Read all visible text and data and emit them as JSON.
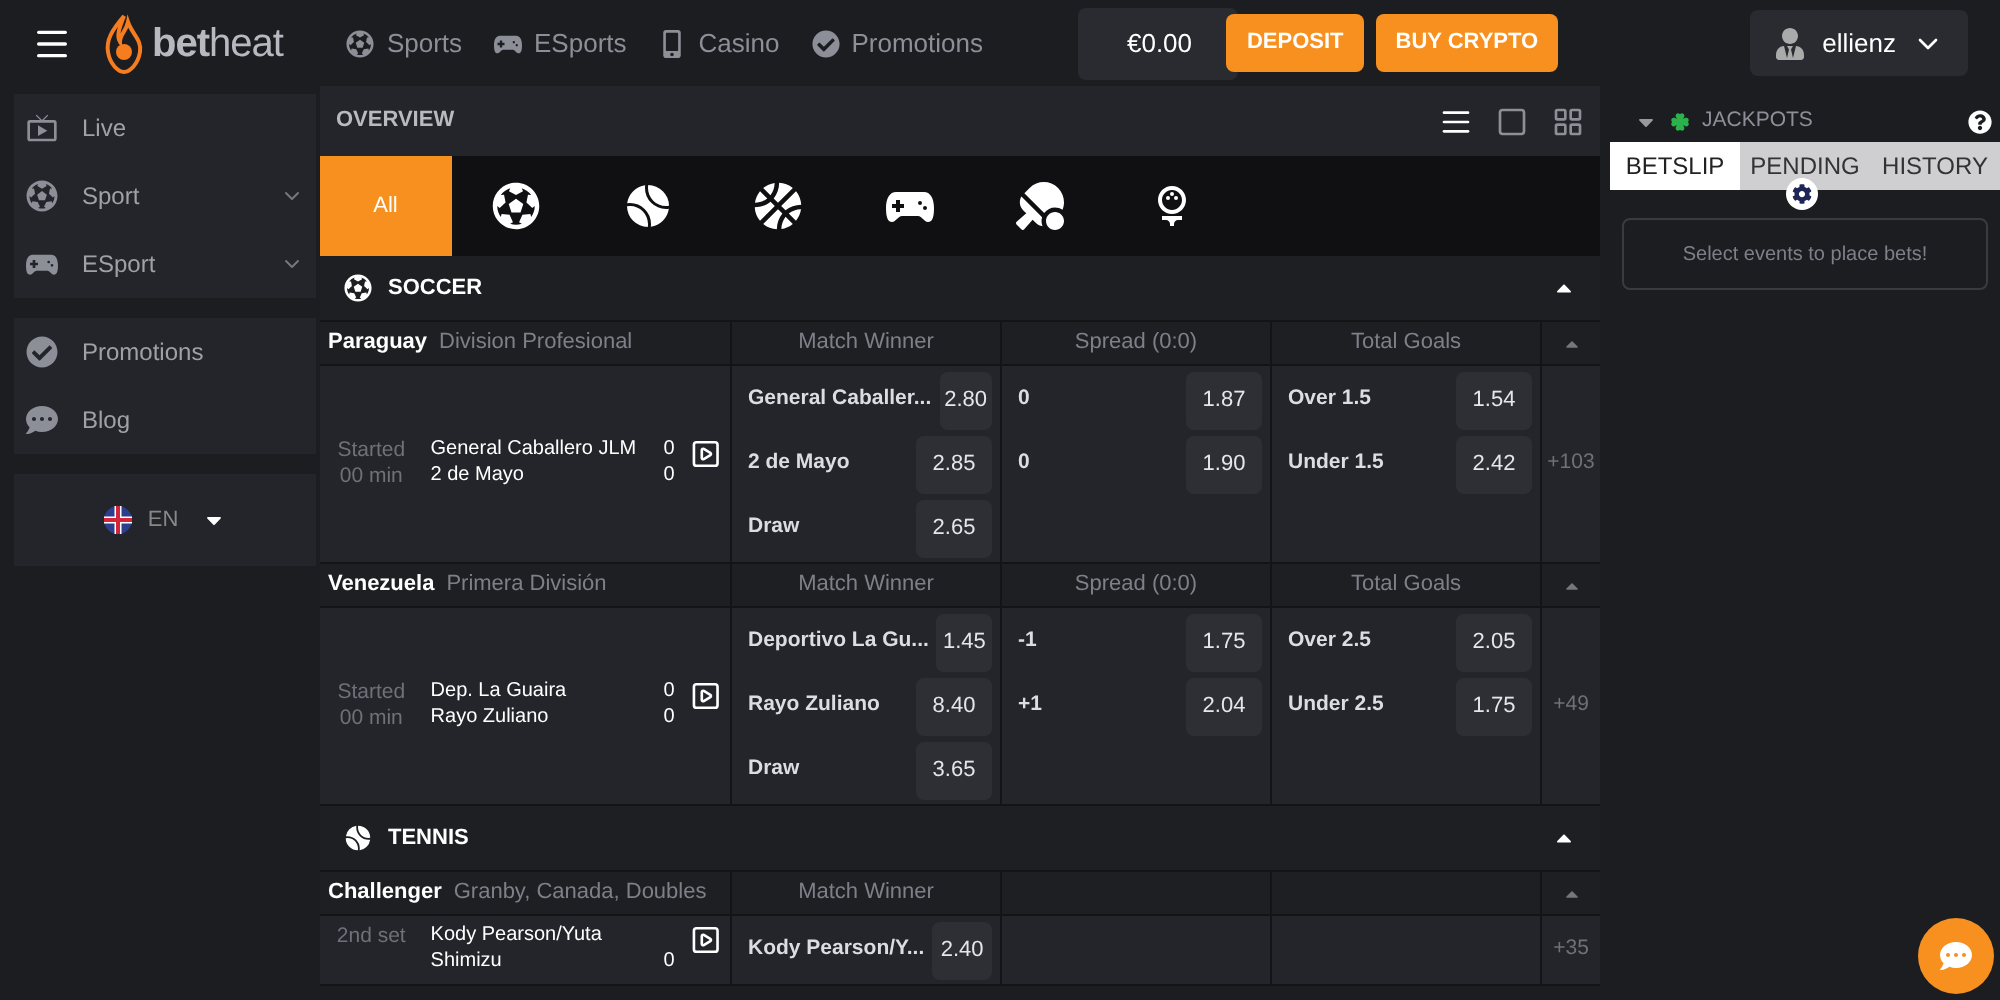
{
  "header": {
    "logo": "**bet**heat",
    "nav": [
      {
        "kind": "sports",
        "label": "Sports"
      },
      {
        "kind": "esports",
        "label": "ESports"
      },
      {
        "kind": "casino",
        "label": "Casino"
      },
      {
        "kind": "promotions",
        "label": "Promotions"
      }
    ],
    "balance": "€0.00",
    "buttons": [
      "DEPOSIT",
      "BUY CRYPTO"
    ],
    "user": "ellienz"
  },
  "sidebar": {
    "groups": [
      [
        {
          "kind": "live",
          "label": "Live",
          "expandable": false
        },
        {
          "kind": "sport",
          "label": "Sport",
          "expandable": true
        },
        {
          "kind": "esport",
          "label": "ESport",
          "expandable": true
        }
      ],
      [
        {
          "kind": "promotions",
          "label": "Promotions",
          "expandable": false
        },
        {
          "kind": "blog",
          "label": "Blog",
          "expandable": false
        }
      ]
    ],
    "language": "EN"
  },
  "overview": {
    "title": "OVERVIEW",
    "views": [
      {
        "kind": "list",
        "selected": true
      },
      {
        "kind": "single",
        "selected": false
      },
      {
        "kind": "grid",
        "selected": false
      }
    ],
    "filters": [
      {
        "kind": "all",
        "label": "All",
        "selected": true
      },
      {
        "kind": "soccer",
        "selected": false
      },
      {
        "kind": "tennis",
        "selected": false
      },
      {
        "kind": "basketball",
        "selected": false
      },
      {
        "kind": "esports",
        "selected": false
      },
      {
        "kind": "table-tennis",
        "selected": false
      },
      {
        "kind": "golf",
        "selected": false
      }
    ]
  },
  "sections": [
    {
      "kind": "soccer",
      "title": "SOCCER",
      "expanded": true,
      "leagues": [
        {
          "country": "Paraguay",
          "league": "Division Profesional",
          "markets": [
            "Match Winner",
            "Spread (0:0)",
            "Total Goals"
          ],
          "status": "Started",
          "time": "00 min",
          "teams": [
            {
              "name": "General Caballero JLM",
              "score": "0"
            },
            {
              "name": "2 de Mayo",
              "score": "0"
            }
          ],
          "odds": [
            [
              {
                "label": "General Caballer...",
                "price": "2.80"
              },
              {
                "label": "2 de Mayo",
                "price": "2.85"
              },
              {
                "label": "Draw",
                "price": "2.65"
              }
            ],
            [
              {
                "label": "0",
                "price": "1.87"
              },
              {
                "label": "0",
                "price": "1.90"
              }
            ],
            [
              {
                "label": "Over 1.5",
                "price": "1.54"
              },
              {
                "label": "Under 1.5",
                "price": "2.42"
              }
            ]
          ],
          "more": "+103"
        },
        {
          "country": "Venezuela",
          "league": "Primera División",
          "markets": [
            "Match Winner",
            "Spread (0:0)",
            "Total Goals"
          ],
          "status": "Started",
          "time": "00 min",
          "teams": [
            {
              "name": "Dep. La Guaira",
              "score": "0"
            },
            {
              "name": "Rayo Zuliano",
              "score": "0"
            }
          ],
          "odds": [
            [
              {
                "label": "Deportivo La Gu...",
                "price": "1.45"
              },
              {
                "label": "Rayo Zuliano",
                "price": "8.40"
              },
              {
                "label": "Draw",
                "price": "3.65"
              }
            ],
            [
              {
                "label": "-1",
                "price": "1.75"
              },
              {
                "label": "+1",
                "price": "2.04"
              }
            ],
            [
              {
                "label": "Over 2.5",
                "price": "2.05"
              },
              {
                "label": "Under 2.5",
                "price": "1.75"
              }
            ]
          ],
          "more": "+49"
        }
      ]
    },
    {
      "kind": "tennis",
      "title": "TENNIS",
      "expanded": true,
      "leagues": [
        {
          "country": "Challenger",
          "league": "Granby, Canada, Doubles",
          "markets": [
            "Match Winner"
          ],
          "status": "2nd set",
          "teams": [
            {
              "name": "Kody Pearson/Yuta Shimizu",
              "score": "0"
            }
          ],
          "odds": [
            [
              {
                "label": "Kody Pearson/Y...",
                "price": "2.40"
              }
            ]
          ],
          "more": "+35"
        }
      ]
    }
  ],
  "betslip": {
    "jackpots": "JACKPOTS",
    "tabs": [
      {
        "label": "BETSLIP",
        "selected": true
      },
      {
        "label": "PENDING",
        "selected": false
      },
      {
        "label": "HISTORY",
        "selected": false
      }
    ],
    "empty": "Select events to place bets!"
  }
}
